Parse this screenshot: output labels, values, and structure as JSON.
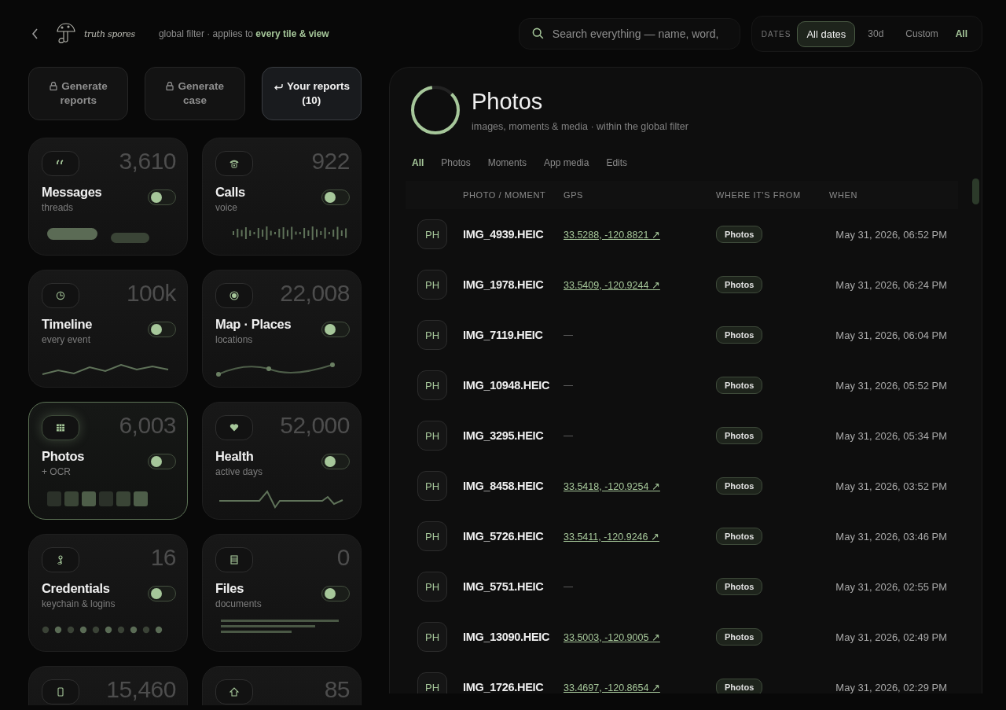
{
  "header": {
    "logo_text": "truth spores",
    "filter_note": "global filter · applies to **every tile & view**"
  },
  "search": {
    "placeholder": "Search everything — name, word,"
  },
  "dates": {
    "label": "DATES",
    "options": [
      {
        "label": "All dates",
        "selected": true
      },
      {
        "label": "30d",
        "selected": false
      },
      {
        "label": "Custom",
        "selected": false
      }
    ],
    "all_link": "All"
  },
  "actions": [
    {
      "label": "Generate reports",
      "kind": "locked"
    },
    {
      "label": "Generate case",
      "kind": "locked"
    },
    {
      "label": "Your reports (10)",
      "kind": "return"
    }
  ],
  "tiles": [
    {
      "title": "Messages",
      "subtitle": "threads",
      "count": "3,610",
      "kind": "bars",
      "on": false,
      "selected": false
    },
    {
      "title": "Calls",
      "subtitle": "voice",
      "count": "922",
      "kind": "wave",
      "on": false,
      "selected": false
    },
    {
      "title": "Timeline",
      "subtitle": "every event",
      "count": "100k",
      "kind": "line",
      "on": false,
      "selected": false
    },
    {
      "title": "Map · Places",
      "subtitle": "locations",
      "count": "22,008",
      "kind": "route",
      "on": false,
      "selected": false
    },
    {
      "title": "Photos",
      "subtitle": "+ OCR",
      "count": "6,003",
      "kind": "squares",
      "on": false,
      "selected": true
    },
    {
      "title": "Health",
      "subtitle": "active days",
      "count": "52,000",
      "kind": "pulse",
      "on": false,
      "selected": false
    },
    {
      "title": "Credentials",
      "subtitle": "keychain & logins",
      "count": "16",
      "kind": "dots",
      "on": false,
      "selected": false
    },
    {
      "title": "Files",
      "subtitle": "documents",
      "count": "0",
      "kind": "doc",
      "on": false,
      "selected": false
    },
    {
      "count": "15,460",
      "kind": "device"
    },
    {
      "count": "85",
      "kind": "home"
    }
  ],
  "panel": {
    "title": "Photos",
    "subtitle": "images, moments & media · within the global filter",
    "tabs": [
      {
        "label": "All",
        "selected": true
      },
      {
        "label": "Photos",
        "selected": false
      },
      {
        "label": "Moments",
        "selected": false
      },
      {
        "label": "App media",
        "selected": false
      },
      {
        "label": "Edits",
        "selected": false
      }
    ],
    "columns": [
      "PHOTO / MOMENT",
      "GPS",
      "WHERE IT'S FROM",
      "WHEN"
    ],
    "rows": [
      {
        "thumb": "PH",
        "name": "IMG_4939.HEIC",
        "gps": "33.5288, -120.8821 ↗",
        "has_gps": true,
        "source": "Photos",
        "when": "May 31, 2026, 06:52 PM"
      },
      {
        "thumb": "PH",
        "name": "IMG_1978.HEIC",
        "gps": "33.5409, -120.9244 ↗",
        "has_gps": true,
        "source": "Photos",
        "when": "May 31, 2026, 06:24 PM"
      },
      {
        "thumb": "PH",
        "name": "IMG_7119.HEIC",
        "gps": "—",
        "has_gps": false,
        "source": "Photos",
        "when": "May 31, 2026, 06:04 PM"
      },
      {
        "thumb": "PH",
        "name": "IMG_10948.HEIC",
        "gps": "—",
        "has_gps": false,
        "source": "Photos",
        "when": "May 31, 2026, 05:52 PM"
      },
      {
        "thumb": "PH",
        "name": "IMG_3295.HEIC",
        "gps": "—",
        "has_gps": false,
        "source": "Photos",
        "when": "May 31, 2026, 05:34 PM"
      },
      {
        "thumb": "PH",
        "name": "IMG_8458.HEIC",
        "gps": "33.5418, -120.9254 ↗",
        "has_gps": true,
        "source": "Photos",
        "when": "May 31, 2026, 03:52 PM"
      },
      {
        "thumb": "PH",
        "name": "IMG_5726.HEIC",
        "gps": "33.5411, -120.9246 ↗",
        "has_gps": true,
        "source": "Photos",
        "when": "May 31, 2026, 03:46 PM"
      },
      {
        "thumb": "PH",
        "name": "IMG_5751.HEIC",
        "gps": "—",
        "has_gps": false,
        "source": "Photos",
        "when": "May 31, 2026, 02:55 PM"
      },
      {
        "thumb": "PH",
        "name": "IMG_13090.HEIC",
        "gps": "33.5003, -120.9005 ↗",
        "has_gps": true,
        "source": "Photos",
        "when": "May 31, 2026, 02:49 PM"
      },
      {
        "thumb": "PH",
        "name": "IMG_1726.HEIC",
        "gps": "33.4697, -120.8654 ↗",
        "has_gps": true,
        "source": "Photos",
        "when": "May 31, 2026, 02:29 PM"
      }
    ]
  }
}
